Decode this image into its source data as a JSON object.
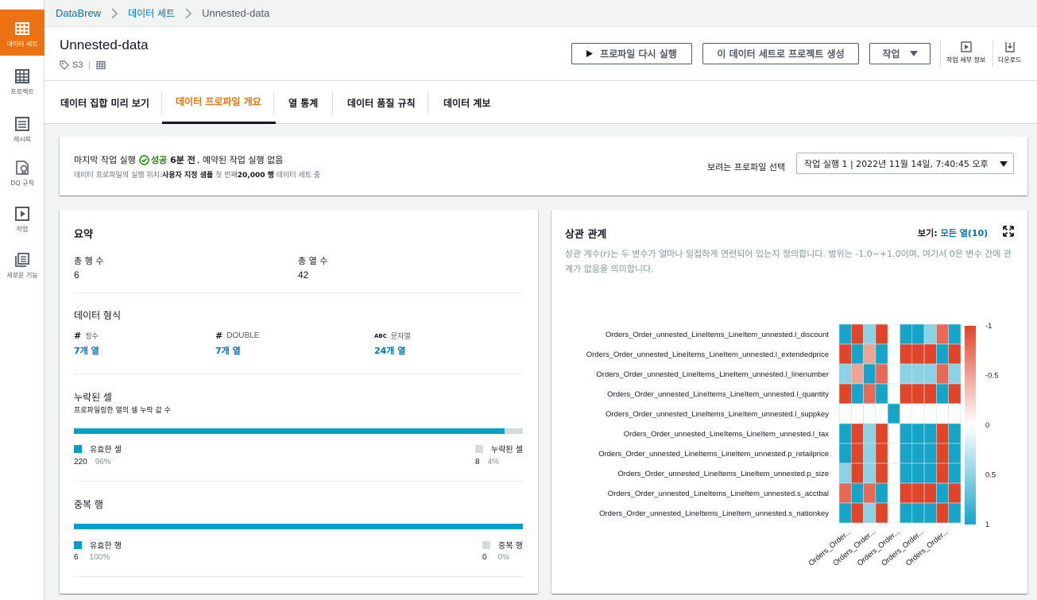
{
  "nav": [
    {
      "label": "데이터 세트",
      "icon": "table-icon",
      "active": true
    },
    {
      "label": "프로젝트",
      "icon": "grid-icon",
      "active": false
    },
    {
      "label": "레시피",
      "icon": "list-icon",
      "active": false
    },
    {
      "label": "DQ 규칙",
      "icon": "dq-rules-icon",
      "active": false
    },
    {
      "label": "작업",
      "icon": "play-icon",
      "active": false
    },
    {
      "label": "새로운 기능",
      "icon": "news-icon",
      "active": false
    }
  ],
  "breadcrumb": {
    "items": [
      "DataBrew",
      "데이터 세트"
    ],
    "current": "Unnested-data"
  },
  "header": {
    "title": "Unnested-data",
    "source": "S3",
    "buttons": {
      "rerun_profile": "프로파일 다시 실행",
      "create_project": "이 데이터 세트로 프로젝트 생성",
      "actions": "작업"
    },
    "job_details": "작업 세부 정보",
    "download": "다운로드"
  },
  "tabs": [
    "데이터 집합 미리 보기",
    "데이터 프로파일 개요",
    "열 통계",
    "데이터 품질 규칙",
    "데이터 계보"
  ],
  "active_tab": 1,
  "status": {
    "last_run_label": "마지막 작업 실행",
    "result": "성공",
    "ago": "6분 전",
    "next": ", 예약된 작업 실행 없음",
    "scope_prefix": "데이터 프로파일의 실행 위치:",
    "scope_sample": "사용자 지정 샘플",
    "scope_first": " 첫 번째",
    "scope_rows": "20,000 행",
    "scope_suffix": " 데이터 세트 중",
    "select_label": "보려는 프로파일 선택",
    "select_value": "작업 실행 1 | 2022년 11월 14일, 7:40:45 오후"
  },
  "summary": {
    "title": "요약",
    "total_rows_label": "총 행 수",
    "total_rows": "6",
    "total_cols_label": "총 열 수",
    "total_cols": "42",
    "format_title": "데이터 형식",
    "types": [
      {
        "sym": "#",
        "name": "정수",
        "count": "7개 열"
      },
      {
        "sym": "#",
        "name": "DOUBLE",
        "count": "7개 열"
      },
      {
        "sym": "ABC",
        "name": "문자열",
        "count": "24개 열"
      }
    ],
    "missing_title": "누락된 셀",
    "missing_sub": "프로파일링한 열의 셀 누락 값 수",
    "missing": {
      "valid_label": "유효한 셀",
      "valid_count": "220",
      "valid_pct": "96%",
      "valid_frac": 0.96,
      "missing_label": "누락된 셀",
      "missing_count": "8",
      "missing_pct": "4%"
    },
    "dup_title": "중복 행",
    "dup": {
      "valid_label": "유효한 행",
      "valid_count": "6",
      "valid_pct": "100%",
      "valid_frac": 1.0,
      "dup_label": "중복 행",
      "dup_count": "0",
      "dup_pct": "0%"
    },
    "colors": {
      "valid": "#00a1c9",
      "missing": "#d5dbdb"
    }
  },
  "correlation": {
    "title": "상관 관계",
    "view_label": "보기:",
    "view_value": "모든 열(10)",
    "description": "상관 계수(r)는 두 변수가 얼마나 밀접하게 연련되어 있는지 정의합니다. 범위는 -1.0~+1.0이며, 여기서 0은 변수 간에 관계가 없음을 의미합니다."
  },
  "chart_data": {
    "type": "heatmap",
    "rows": [
      "Orders_Order_unnested_LineItems_LineItem_unnested.l_discount",
      "Orders_Order_unnested_LineItems_LineItem_unnested.l_extendedprice",
      "Orders_Order_unnested_LineItems_LineItem_unnested.l_linenumber",
      "Orders_Order_unnested_LineItems_LineItem_unnested.l_quantity",
      "Orders_Order_unnested_LineItems_LineItem_unnested.l_suppkey",
      "Orders_Order_unnested_LineItems_LineItem_unnested.l_tax",
      "Orders_Order_unnested_LineItems_LineItem_unnested.p_retailprice",
      "Orders_Order_unnested_LineItems_LineItem_unnested.p_size",
      "Orders_Order_unnested_LineItems_LineItem_unnested.s_acctbal",
      "Orders_Order_unnested_LineItems_LineItem_unnested.s_nationkey"
    ],
    "columns": [
      "Orders_Order...",
      "Orders_Order...",
      "Orders_Order...",
      "Orders_Order...",
      "Orders_Order..."
    ],
    "values": [
      [
        1,
        -1,
        0.5,
        -1,
        0,
        1,
        1,
        0.5,
        -0.8,
        1
      ],
      [
        -1,
        1,
        -0.5,
        1,
        0,
        -1,
        -1,
        -1,
        1,
        -1
      ],
      [
        0.5,
        -0.5,
        1,
        -0.8,
        0,
        0.5,
        0.5,
        0.5,
        -0.8,
        0.5
      ],
      [
        -1,
        1,
        -0.8,
        1,
        0,
        -1,
        -1,
        -1,
        1,
        -1
      ],
      [
        0,
        0,
        0,
        0,
        1,
        0,
        0,
        0,
        0,
        0
      ],
      [
        1,
        -1,
        0.5,
        -1,
        0,
        1,
        1,
        1,
        -1,
        1
      ],
      [
        1,
        -1,
        0.5,
        -1,
        0,
        1,
        1,
        1,
        -1,
        1
      ],
      [
        0.5,
        -1,
        0.5,
        -1,
        0,
        1,
        1,
        1,
        -1,
        1
      ],
      [
        -0.8,
        1,
        -0.8,
        1,
        0,
        -1,
        -1,
        -1,
        1,
        -1
      ],
      [
        1,
        -1,
        0.5,
        -1,
        0,
        1,
        1,
        1,
        -1,
        1
      ]
    ],
    "colorbar_ticks": [
      "-1",
      "-0.5",
      "0",
      "0.5",
      "1"
    ],
    "zlim": [
      -1,
      1
    ],
    "colors": {
      "negative": "#e0452a",
      "zero": "#ffffff",
      "positive": "#16a5c9"
    }
  }
}
